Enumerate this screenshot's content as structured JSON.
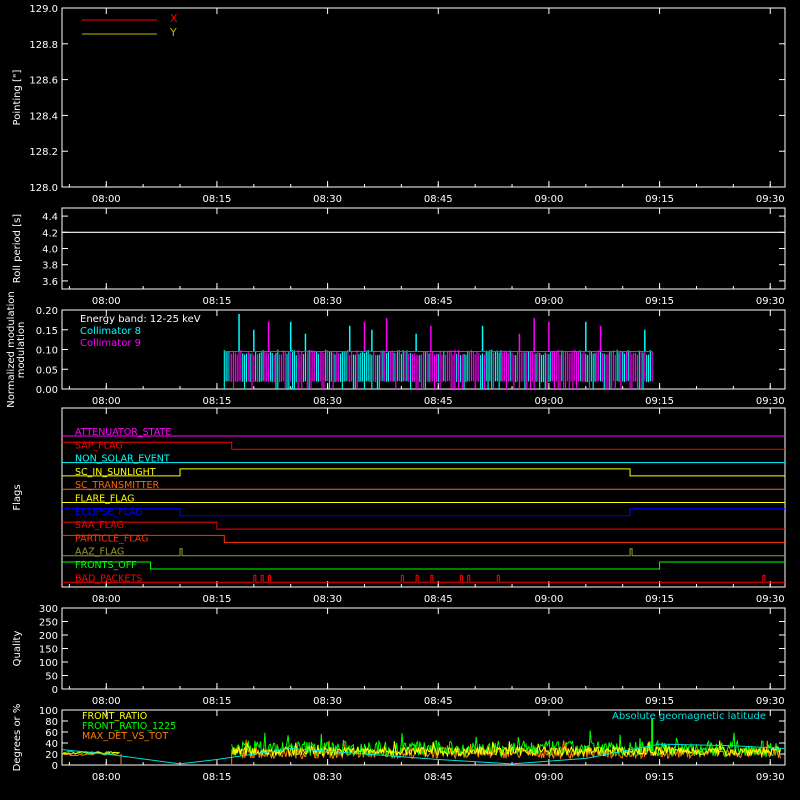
{
  "colors": {
    "background": "#000000",
    "frame": "#ffffff",
    "x": "#ff0000",
    "y": "#b8b800",
    "collimator8": "#00ffff",
    "collimator9": "#ff00ff",
    "roll": "#ffffff",
    "front_ratio": "#ffff00",
    "front_ratio_1225": "#00ff00",
    "max_det_vs_tot": "#ff8000",
    "geomag": "#00e0e0"
  },
  "chart_data": [
    {
      "type": "line",
      "panel": "pointing",
      "ylabel": "Pointing [\"]",
      "ylim": [
        128.0,
        129.0
      ],
      "yticks": [
        "128.0",
        "128.2",
        "128.4",
        "128.6",
        "128.8",
        "129.0"
      ],
      "xticks": [
        "08:00",
        "08:15",
        "08:30",
        "08:45",
        "09:00",
        "09:15",
        "09:30"
      ],
      "xlim_minutes": [
        474,
        572
      ],
      "series": [
        {
          "name": "X",
          "values": []
        },
        {
          "name": "Y",
          "values": []
        }
      ],
      "legend": "top-left"
    },
    {
      "type": "line",
      "panel": "roll",
      "ylabel": "Roll period [s]",
      "ylim": [
        3.5,
        4.5
      ],
      "yticks": [
        "3.6",
        "3.8",
        "4.0",
        "4.2",
        "4.4"
      ],
      "xticks": [
        "08:00",
        "08:15",
        "08:30",
        "08:45",
        "09:00",
        "09:15",
        "09:30"
      ],
      "series": [
        {
          "x": [
            "07:54",
            "09:32"
          ],
          "values": [
            4.2,
            4.2
          ]
        }
      ]
    },
    {
      "type": "line",
      "panel": "modulation",
      "ylabel": "Normalized modulation",
      "ylim": [
        0.0,
        0.2
      ],
      "yticks": [
        "0.00",
        "0.05",
        "0.10",
        "0.15",
        "0.20"
      ],
      "xticks": [
        "08:00",
        "08:15",
        "08:30",
        "08:45",
        "09:00",
        "09:15",
        "09:30"
      ],
      "active_interval": [
        "08:16",
        "09:14"
      ],
      "typical_value": 0.095,
      "annotation": "Energy band: 12-25 keV",
      "series": [
        {
          "name": "Collimator 8",
          "peaks_x": [
            "08:18",
            "08:20",
            "08:25",
            "08:27",
            "08:33",
            "08:36",
            "08:42",
            "08:51",
            "09:05",
            "09:13"
          ],
          "peaks_y": [
            0.19,
            0.15,
            0.17,
            0.14,
            0.16,
            0.15,
            0.14,
            0.16,
            0.17,
            0.15
          ]
        },
        {
          "name": "Collimator 9",
          "peaks_x": [
            "08:22",
            "08:35",
            "08:38",
            "08:44",
            "08:56",
            "08:58",
            "09:00",
            "09:07"
          ],
          "peaks_y": [
            0.17,
            0.17,
            0.18,
            0.16,
            0.14,
            0.18,
            0.17,
            0.16
          ]
        }
      ]
    },
    {
      "type": "line",
      "panel": "flags",
      "ylabel": "Flags",
      "xticks": [
        "08:00",
        "08:15",
        "08:30",
        "08:45",
        "09:00",
        "09:15",
        "09:30"
      ],
      "flags": [
        {
          "name": "ATTENUATOR_STATE",
          "color": "#ff00ff",
          "steps": []
        },
        {
          "name": "SAP_FLAG",
          "color": "#ff0000",
          "steps": [
            {
              "x": "08:17",
              "state": 0
            }
          ]
        },
        {
          "name": "NON_SOLAR_EVENT",
          "color": "#00ffff",
          "steps": []
        },
        {
          "name": "SC_IN_SUNLIGHT",
          "color": "#ffff00",
          "steps": [
            {
              "x": "08:10",
              "state": 1
            },
            {
              "x": "09:11",
              "state": 0
            }
          ]
        },
        {
          "name": "SC_TRANSMITTER",
          "color": "#ff6600",
          "steps": []
        },
        {
          "name": "FLARE_FLAG",
          "color": "#ffff00",
          "steps": []
        },
        {
          "name": "ECLIPSE_FLAG",
          "color": "#0000ff",
          "steps": [
            {
              "x": "08:10",
              "state": 0
            },
            {
              "x": "09:11",
              "state": 1
            }
          ]
        },
        {
          "name": "SAA_FLAG",
          "color": "#ff0000",
          "steps": [
            {
              "x": "08:15",
              "state": 0
            }
          ]
        },
        {
          "name": "PARTICLE_FLAG",
          "color": "#ff3300",
          "steps": [
            {
              "x": "08:16",
              "state": 0
            }
          ]
        },
        {
          "name": "AAZ_FLAG",
          "color": "#999933",
          "pulses": [
            "08:10",
            "09:11"
          ]
        },
        {
          "name": "FRONTS_OFF",
          "color": "#00ff00",
          "steps": [
            {
              "x": "08:06",
              "state": 0
            },
            {
              "x": "09:15",
              "state": 1
            }
          ]
        },
        {
          "name": "BAD_PACKETS",
          "color": "#ff0000",
          "pulses": [
            "08:20",
            "08:21",
            "08:22",
            "08:40",
            "08:42",
            "08:44",
            "08:48",
            "08:49",
            "08:53",
            "09:29"
          ]
        }
      ]
    },
    {
      "type": "line",
      "panel": "quality",
      "ylabel": "Quality",
      "ylim": [
        0,
        300
      ],
      "yticks": [
        "0",
        "50",
        "100",
        "150",
        "200",
        "250",
        "300"
      ],
      "xticks": [
        "08:00",
        "08:15",
        "08:30",
        "08:45",
        "09:00",
        "09:15",
        "09:30"
      ],
      "series": []
    },
    {
      "type": "line",
      "panel": "ratios",
      "ylabel": "Degrees or %",
      "ylim": [
        0,
        100
      ],
      "yticks": [
        "0",
        "20",
        "40",
        "60",
        "80",
        "100"
      ],
      "xticks": [
        "08:00",
        "08:15",
        "08:30",
        "08:45",
        "09:00",
        "09:15",
        "09:30"
      ],
      "series": [
        {
          "name": "FRONT_RATIO",
          "level_before": 22,
          "level_after": 25
        },
        {
          "name": "FRONT_RATIO_1225",
          "level_before": 22,
          "level_after": 30,
          "spike": {
            "x": "09:14",
            "y": 85
          }
        },
        {
          "name": "MAX_DET_VS_TOT",
          "level_before": 20,
          "level_after": 22
        },
        {
          "name": "Absolute geomagnetic latitude",
          "x": [
            "07:54",
            "08:00",
            "08:10",
            "08:15",
            "08:25",
            "08:35",
            "08:45",
            "08:55",
            "09:05",
            "09:15",
            "09:25",
            "09:32"
          ],
          "values": [
            28,
            20,
            2,
            10,
            30,
            20,
            10,
            2,
            12,
            38,
            35,
            30
          ]
        }
      ],
      "legend": "top-left"
    }
  ],
  "legend_pointing": {
    "x": "X",
    "y": "Y"
  },
  "legend_modulation": {
    "energy": "Energy band: 12-25 keV",
    "c8": "Collimator 8",
    "c9": "Collimator 9"
  },
  "legend_ratios": {
    "front_ratio": "FRONT_RATIO",
    "front_ratio_1225": "FRONT_RATIO_1225",
    "max_det": "MAX_DET_VS_TOT",
    "geomag": "Absolute geomagnetic latitude"
  }
}
